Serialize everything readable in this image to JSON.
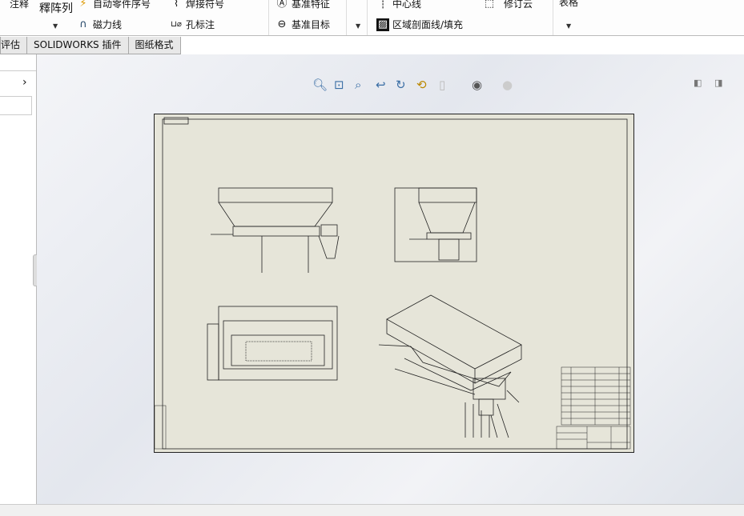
{
  "ribbon": {
    "annotation": "注释",
    "pattern": "釋阵列",
    "auto_balloon": "自动零件序号",
    "weld": "焊接符号",
    "datum_feature": "基准特征",
    "center_line": "中心线",
    "revision_cloud": "修订云",
    "magnet_line": "磁力线",
    "hole_callout": "孔标注",
    "datum_target": "基准目标",
    "area_hatch": "区域剖面线/填充",
    "tables": "表格"
  },
  "tabs": [
    "评估",
    "SOLIDWORKS 插件",
    "图纸格式"
  ],
  "view_tools": [
    "zoom-to-fit-icon",
    "zoom-to-area-icon",
    "zoom-in-out-icon",
    "previous-view-icon",
    "redraw-icon",
    "rotate-icon",
    "display-style-icon",
    "hide-show-icon",
    "appearance-icon"
  ],
  "colors": {
    "sheet": "#e6e5d9",
    "accent": "#3a6ea5"
  }
}
